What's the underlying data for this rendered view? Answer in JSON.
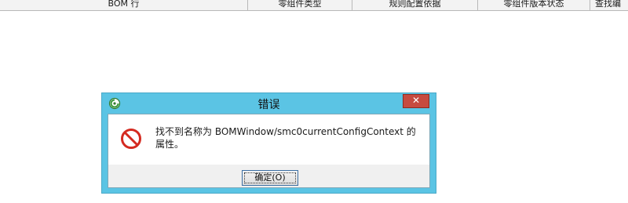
{
  "table": {
    "columns": [
      "BOM 行",
      "零组件类型",
      "规则配置依据",
      "零组件版本状态",
      "查找编"
    ]
  },
  "dialog": {
    "title": "错误",
    "close_label": "✕",
    "message": "找不到名称为 BOMWindow/smc0currentConfigContext 的属性。",
    "ok_label": "确定(O)"
  },
  "icons": {
    "title_icon": "teamcenter-app-icon",
    "message_icon": "error-no-entry-icon"
  },
  "colors": {
    "title_bar": "#5bc4e4",
    "close_button": "#c74a3f",
    "error_red": "#d42a20"
  }
}
